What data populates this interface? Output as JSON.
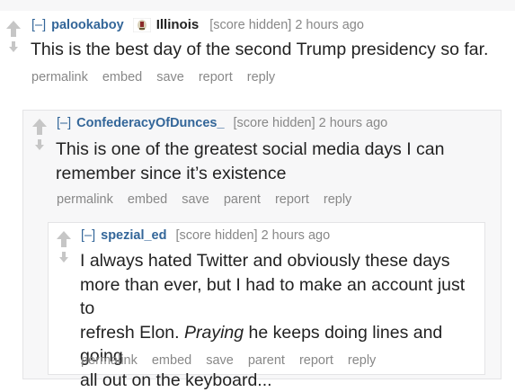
{
  "comments": [
    {
      "collapse": "[–]",
      "author": "palookaboy",
      "flair": "Illinois",
      "flair_icon": "illinois-flag-icon",
      "score": "[score hidden]",
      "time": "2 hours ago",
      "body": "This is the best day of the second Trump presidency so far.",
      "buttons": [
        "permalink",
        "embed",
        "save",
        "report",
        "reply"
      ]
    },
    {
      "collapse": "[–]",
      "author": "ConfederacyOfDunces_",
      "score": "[score hidden]",
      "time": "2 hours ago",
      "body_lines": [
        "This is one of the greatest social media days I can",
        "remember since it’s existence"
      ],
      "buttons": [
        "permalink",
        "embed",
        "save",
        "parent",
        "report",
        "reply"
      ]
    },
    {
      "collapse": "[–]",
      "author": "spezial_ed",
      "score": "[score hidden]",
      "time": "2 hours ago",
      "body_lines": [
        "I always hated Twitter and obviously these days",
        "more than ever, but I had to make an account just to",
        "refresh Elon. ",
        "Praying",
        " he keeps doing lines and going",
        "all out on the keyboard..."
      ],
      "buttons": [
        "permalink",
        "embed",
        "save",
        "parent",
        "report",
        "reply"
      ]
    }
  ]
}
